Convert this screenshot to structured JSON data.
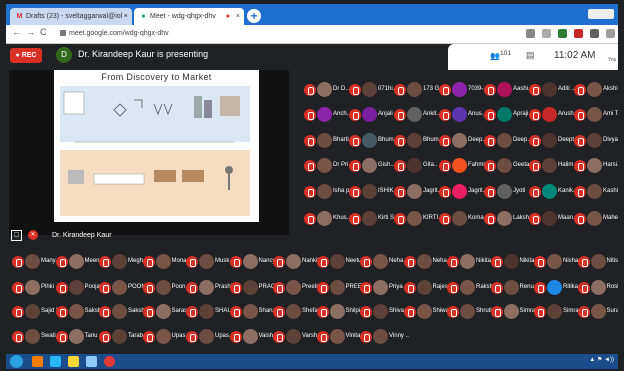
{
  "browser": {
    "tabs": [
      {
        "icon": "gmail-icon",
        "title": "Drafts (23) - sveltaggarwal@iol -"
      },
      {
        "icon": "meet-icon",
        "title": "Meet - wdg-qhgx-dhv"
      }
    ],
    "url": "meet.google.com/wdg-qhgx-dhv"
  },
  "meet": {
    "rec_label": "REC",
    "presenter_initial": "D",
    "presenting_text": "Dr. Kirandeep Kaur is presenting",
    "participant_count": "101",
    "time": "11:02 AM",
    "you_label": "You",
    "presentation": {
      "slide_title": "From Discovery to Market",
      "label": "Dr. Kirandeep Kaur"
    }
  },
  "participants": [
    {
      "name": "Dr D..",
      "color": "#8d6e63"
    },
    {
      "name": "071hi..",
      "color": "#5d4037"
    },
    {
      "name": "173 G..",
      "color": "#6d4c41"
    },
    {
      "name": "7039-..",
      "color": "#8e24aa"
    },
    {
      "name": "Aashi..",
      "color": "#ad1457"
    },
    {
      "name": "Aditi ..",
      "color": "#4e342e"
    },
    {
      "name": "Akshi..",
      "color": "#795548"
    },
    {
      "name": "Anch..",
      "color": "#8e24aa"
    },
    {
      "name": "Anjali ..",
      "color": "#7b1fa2"
    },
    {
      "name": "Ankit..",
      "color": "#616161"
    },
    {
      "name": "Anus..",
      "color": "#5e35b1"
    },
    {
      "name": "Apraji..",
      "color": "#00796b"
    },
    {
      "name": "Arush..",
      "color": "#c62828"
    },
    {
      "name": "Ami T..",
      "color": "#795548"
    },
    {
      "name": "Bharti..",
      "color": "#6d4c41"
    },
    {
      "name": "Bhum..",
      "color": "#455a64"
    },
    {
      "name": "Bhum..",
      "color": "#5d4037"
    },
    {
      "name": "Deep..",
      "color": "#8d6e63"
    },
    {
      "name": "Deep..",
      "color": "#6d4c41"
    },
    {
      "name": "Deept..",
      "color": "#4e342e"
    },
    {
      "name": "Divya..",
      "color": "#5d4037"
    },
    {
      "name": "Dr Pri..",
      "color": "#795548"
    },
    {
      "name": "Gish..",
      "color": "#8d6e63"
    },
    {
      "name": "Gita..",
      "color": "#4e342e"
    },
    {
      "name": "Fahmi..",
      "color": "#f4511e"
    },
    {
      "name": "Geeta..",
      "color": "#6d4c41"
    },
    {
      "name": "Halim..",
      "color": "#5d4037"
    },
    {
      "name": "Harsi..",
      "color": "#8d6e63"
    },
    {
      "name": "Isha p..",
      "color": "#6d4c41"
    },
    {
      "name": "ISHIK..",
      "color": "#5d4037"
    },
    {
      "name": "Jagrit..",
      "color": "#8d6e63"
    },
    {
      "name": "Jagrit..",
      "color": "#e91e63"
    },
    {
      "name": "Jyoti",
      "color": "#616161"
    },
    {
      "name": "Kanik..",
      "color": "#00897b"
    },
    {
      "name": "Kashi..",
      "color": "#6d4c41"
    },
    {
      "name": "Khus..",
      "color": "#8d6e63"
    },
    {
      "name": "Kirti S..",
      "color": "#5d4037"
    },
    {
      "name": "KIRTI ..",
      "color": "#795548"
    },
    {
      "name": "Koma..",
      "color": "#6d4c41"
    },
    {
      "name": "Laksh..",
      "color": "#8d6e63"
    },
    {
      "name": "Maan..",
      "color": "#4e342e"
    },
    {
      "name": "Mahe..",
      "color": "#795548"
    },
    {
      "name": "Many..",
      "color": "#6d4c41"
    },
    {
      "name": "Meen..",
      "color": "#8d6e63"
    },
    {
      "name": "Megh..",
      "color": "#5d4037"
    },
    {
      "name": "Mona..",
      "color": "#795548"
    },
    {
      "name": "Musk..",
      "color": "#6d4c41"
    },
    {
      "name": "Nancy",
      "color": "#8d6e63"
    },
    {
      "name": "Nankit..",
      "color": "#8d6e63"
    },
    {
      "name": "Neetu..",
      "color": "#5d4037"
    },
    {
      "name": "Neha ..",
      "color": "#795548"
    },
    {
      "name": "Neha ..",
      "color": "#6d4c41"
    },
    {
      "name": "Nikita..",
      "color": "#8d6e63"
    },
    {
      "name": "Nikita..",
      "color": "#4e342e"
    },
    {
      "name": "Nisha..",
      "color": "#795548"
    },
    {
      "name": "Nitish..",
      "color": "#6d4c41"
    },
    {
      "name": "Pihki ..",
      "color": "#8d6e63"
    },
    {
      "name": "Pooja..",
      "color": "#5d4037"
    },
    {
      "name": "POON..",
      "color": "#795548"
    },
    {
      "name": "Poon..",
      "color": "#6d4c41"
    },
    {
      "name": "Prashi..",
      "color": "#8d6e63"
    },
    {
      "name": "PRAC..",
      "color": "#5d4037"
    },
    {
      "name": "Preeti",
      "color": "#795548"
    },
    {
      "name": "PREER..",
      "color": "#6d4c41"
    },
    {
      "name": "Priya ..",
      "color": "#8d6e63"
    },
    {
      "name": "Rajes..",
      "color": "#5d4037"
    },
    {
      "name": "Raksh..",
      "color": "#795548"
    },
    {
      "name": "Renu ..",
      "color": "#6d4c41"
    },
    {
      "name": "Ritika..",
      "color": "#1e88e5"
    },
    {
      "name": "Rosh..",
      "color": "#8d6e63"
    },
    {
      "name": "Sajid I..",
      "color": "#5d4037"
    },
    {
      "name": "Saksh..",
      "color": "#795548"
    },
    {
      "name": "Saksh..",
      "color": "#6d4c41"
    },
    {
      "name": "Saras..",
      "color": "#8d6e63"
    },
    {
      "name": "SHAI..",
      "color": "#5d4037"
    },
    {
      "name": "Sharu..",
      "color": "#795548"
    },
    {
      "name": "Shefa..",
      "color": "#6d4c41"
    },
    {
      "name": "Shilpi..",
      "color": "#8d6e63"
    },
    {
      "name": "Shiva..",
      "color": "#5d4037"
    },
    {
      "name": "Shiwa..",
      "color": "#795548"
    },
    {
      "name": "Shruti..",
      "color": "#6d4c41"
    },
    {
      "name": "Simran",
      "color": "#8d6e63"
    },
    {
      "name": "Simra..",
      "color": "#5d4037"
    },
    {
      "name": "Suravi..",
      "color": "#795548"
    },
    {
      "name": "Swati..",
      "color": "#6d4c41"
    },
    {
      "name": "Tanu ..",
      "color": "#8d6e63"
    },
    {
      "name": "Tarab..",
      "color": "#5d4037"
    },
    {
      "name": "Upas..",
      "color": "#795548"
    },
    {
      "name": "Upas..",
      "color": "#6d4c41"
    },
    {
      "name": "Vaish..",
      "color": "#8d6e63"
    },
    {
      "name": "Varsh..",
      "color": "#5d4037"
    },
    {
      "name": "Vinita..",
      "color": "#795548"
    },
    {
      "name": "Vinny ..",
      "color": "#6d4c41"
    }
  ]
}
